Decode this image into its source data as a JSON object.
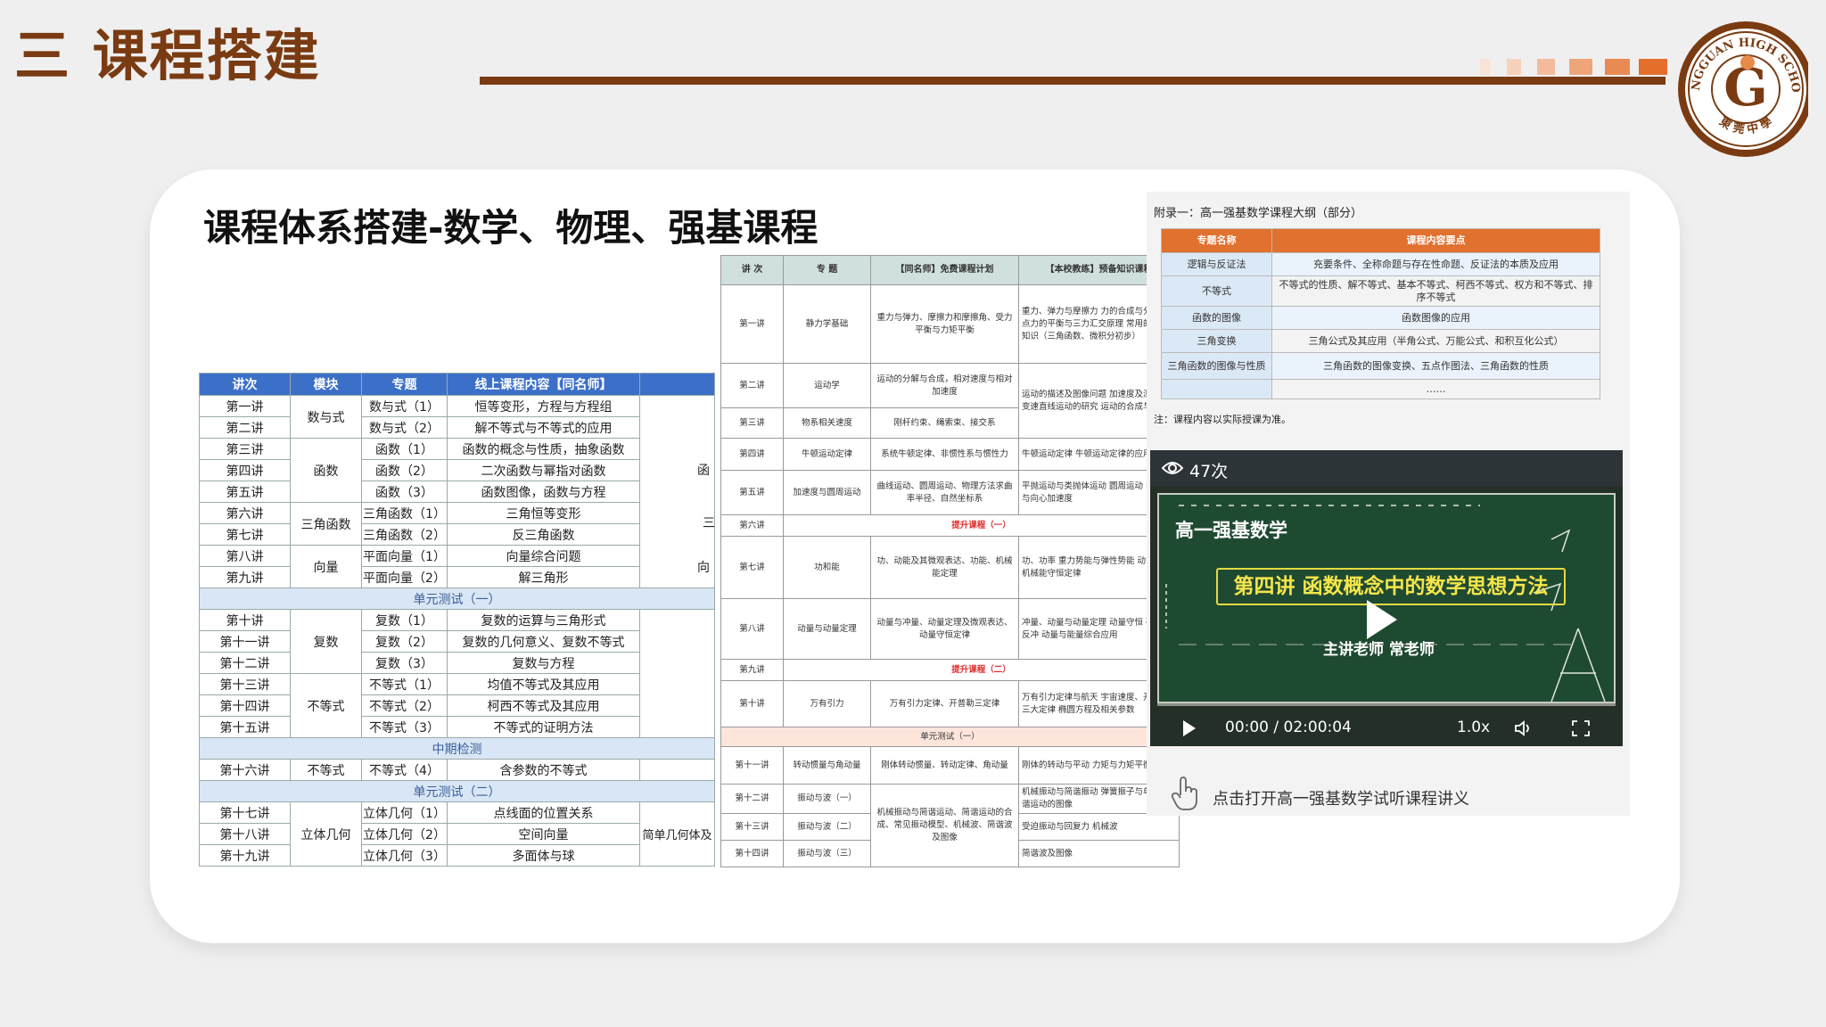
{
  "header": {
    "title": "三 课程搭建",
    "accent_color": "#7a3b12",
    "logo_text": "DONGGUAN HIGH SCHOOL",
    "logo_cn": "東莞中學"
  },
  "card": {
    "title": "课程体系搭建-数学、物理、强基课程"
  },
  "math_table": {
    "headers": [
      "讲次",
      "模块",
      "专题",
      "线上课程内容【同名师】"
    ],
    "side_labels": [
      "函",
      "三",
      "向",
      "简单几何体及"
    ],
    "rows": [
      [
        "第一讲",
        "数与式",
        "数与式（1）",
        "恒等变形，方程与方程组"
      ],
      [
        "第二讲",
        "",
        "数与式（2）",
        "解不等式与不等式的应用"
      ],
      [
        "第三讲",
        "函数",
        "函数（1）",
        "函数的概念与性质，抽象函数"
      ],
      [
        "第四讲",
        "",
        "函数（2）",
        "二次函数与幂指对函数"
      ],
      [
        "第五讲",
        "",
        "函数（3）",
        "函数图像，函数与方程"
      ],
      [
        "第六讲",
        "三角函数",
        "三角函数（1）",
        "三角恒等变形"
      ],
      [
        "第七讲",
        "",
        "三角函数（2）",
        "反三角函数"
      ],
      [
        "第八讲",
        "向量",
        "平面向量（1）",
        "向量综合问题"
      ],
      [
        "第九讲",
        "",
        "平面向量（2）",
        "解三角形"
      ],
      [
        "单元测试（一）"
      ],
      [
        "第十讲",
        "复数",
        "复数（1）",
        "复数的运算与三角形式"
      ],
      [
        "第十一讲",
        "",
        "复数（2）",
        "复数的几何意义、复数不等式"
      ],
      [
        "第十二讲",
        "",
        "复数（3）",
        "复数与方程"
      ],
      [
        "第十三讲",
        "不等式",
        "不等式（1）",
        "均值不等式及其应用"
      ],
      [
        "第十四讲",
        "",
        "不等式（2）",
        "柯西不等式及其应用"
      ],
      [
        "第十五讲",
        "",
        "不等式（3）",
        "不等式的证明方法"
      ],
      [
        "中期检测"
      ],
      [
        "第十六讲",
        "不等式",
        "不等式（4）",
        "含参数的不等式"
      ],
      [
        "单元测试（二）"
      ],
      [
        "第十七讲",
        "立体几何",
        "立体几何（1）",
        "点线面的位置关系"
      ],
      [
        "第十八讲",
        "",
        "立体几何（2）",
        "空间向量"
      ],
      [
        "第十九讲",
        "",
        "立体几何（3）",
        "多面体与球"
      ]
    ]
  },
  "physics_table": {
    "headers": [
      "讲 次",
      "专 题",
      "【同名师】免费课程计划",
      "【本校教练】预备知识课程"
    ],
    "rows": [
      [
        "第一讲",
        "静力学基础",
        "重力与弹力、摩擦力和摩擦角、受力平衡与力矩平衡",
        "重力、弹力与摩擦力 力的合成与分解 共点力的平衡与三力汇交原理 常用的数学知识（三角函数、微积分初步）"
      ],
      [
        "第二讲",
        "运动学",
        "运动的分解与合成，相对速度与相对加速度",
        "运动的描述及图像问题 加速度及测量 匀变速直线运动的研究 运动的合成与分解"
      ],
      [
        "第三讲",
        "物系相关速度",
        "刚杆约束、绳索束、接交系",
        ""
      ],
      [
        "第四讲",
        "牛顿运动定律",
        "系统牛顿定律、非惯性系与惯性力",
        "牛顿运动定律 牛顿运动定律的应用"
      ],
      [
        "第五讲",
        "加速度与圆周运动",
        "曲线运动、圆周运动、物理方法求曲率半径、自然坐标系",
        "平抛运动与类抛体运动 圆周运动 向心力与向心加速度"
      ],
      [
        "第六讲",
        "",
        "提升课程（一）",
        ""
      ],
      [
        "第七讲",
        "功和能",
        "功、动能及其微观表达、功能、机械能定理",
        "功、功率 重力势能与弹性势能 动能定理 机械能守恒定律"
      ],
      [
        "第八讲",
        "动量与动量定理",
        "动量与冲量、动量定理及微观表达、动量守恒定律",
        "冲量、动量与动量定理 动量守恒 碰撞与反冲 动量与能量综合应用"
      ],
      [
        "第九讲",
        "",
        "提升课程（二）",
        ""
      ],
      [
        "第十讲",
        "万有引力",
        "万有引力定律、开普勒三定律",
        "万有引力定律与航天 宇宙速度、开普勒三大定律 椭圆方程及相关参数"
      ],
      [
        "",
        "",
        "单元测试（一）",
        ""
      ],
      [
        "第十一讲",
        "转动惯量与角动量",
        "刚体转动惯量、转动定律、角动量",
        "刚体的转动与平动 力矩与力矩平衡"
      ],
      [
        "第十二讲",
        "振动与波（一）",
        "机械振动与简谐运动、简谐运动的合成、常见振动模型、机械波、简谐波及图像",
        "机械振动与简谐振动 弹簧振子与单摆 简谐运动的图像"
      ],
      [
        "第十三讲",
        "振动与波（二）",
        "",
        "受迫振动与回复力 机械波"
      ],
      [
        "第十四讲",
        "振动与波（三）",
        "",
        "简谐波及图像"
      ]
    ]
  },
  "appendix": {
    "title": "附录一：高一强基数学课程大纲（部分）",
    "headers": [
      "专题名称",
      "课程内容要点"
    ],
    "rows": [
      [
        "逻辑与反证法",
        "充要条件、全称命题与存在性命题、反证法的本质及应用"
      ],
      [
        "不等式",
        "不等式的性质、解不等式、基本不等式、柯西不等式、权方和不等式、排序不等式"
      ],
      [
        "函数的图像",
        "函数图像的应用"
      ],
      [
        "三角变换",
        "三角公式及其应用（半角公式、万能公式、和积互化公式）"
      ],
      [
        "三角函数的图像与性质",
        "三角函数的图像变换、五点作图法、三角函数的性质"
      ],
      [
        "",
        "……"
      ]
    ],
    "note": "注：课程内容以实际授课为准。"
  },
  "video": {
    "views": "47次",
    "board_subtitle": "高一强基数学",
    "banner": "第四讲 函数概念中的数学思想方法",
    "teacher": "主讲老师 常老师",
    "time": "00:00 / 02:00:04",
    "speed": "1.0x"
  },
  "hint": {
    "text": "点击打开高一强基数学试听课程讲义"
  }
}
